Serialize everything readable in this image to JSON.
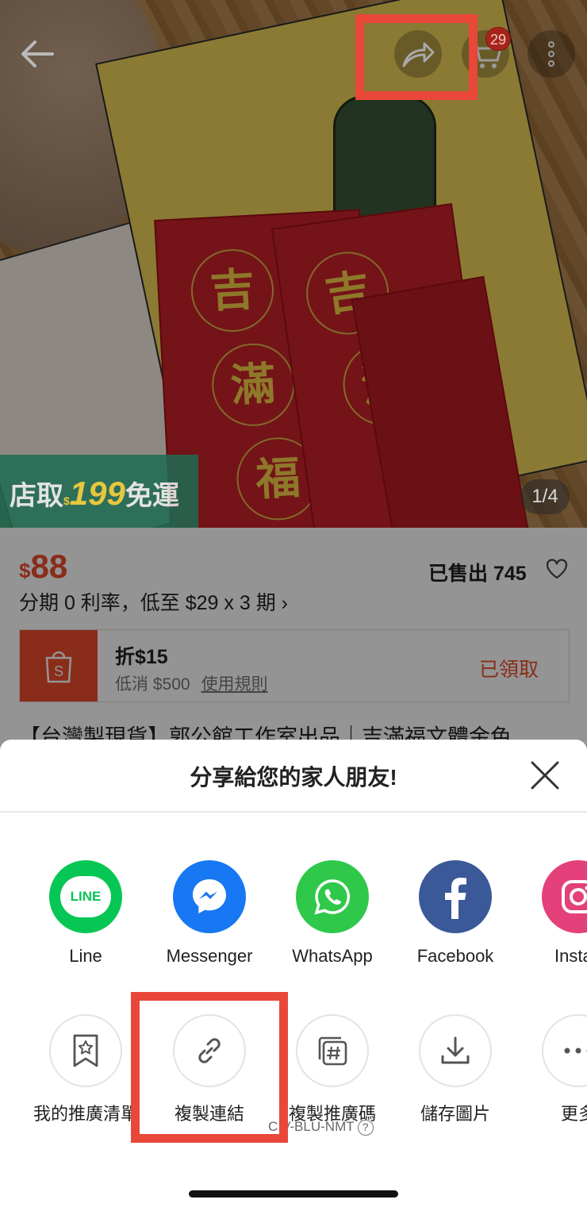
{
  "product": {
    "promo_prefix": "店取",
    "promo_currency": "$",
    "promo_number": "199",
    "promo_suffix": "免運",
    "page_indicator": "1/4",
    "price_symbol": "$",
    "price_value": "88",
    "sold_label": "已售出 745",
    "installment": "分期 0 利率，低至 $29 x 3 期 ›",
    "voucher": {
      "title": "折$15",
      "min_spend": "低消 $500",
      "rules": "使用規則",
      "status": "已領取"
    },
    "title": "【台灣製現貨】郭公館工作室出品｜吉滿福文體金色"
  },
  "envelope_chars": [
    "吉",
    "滿",
    "福"
  ],
  "nav": {
    "cart_badge": "29",
    "icons": [
      "back-arrow-icon",
      "share-icon",
      "cart-icon",
      "more-vertical-icon"
    ]
  },
  "share_sheet": {
    "title": "分享給您的家人朋友!",
    "apps": [
      {
        "label": "Line",
        "icon": "line-icon",
        "color": "#06c755"
      },
      {
        "label": "Messenger",
        "icon": "messenger-icon",
        "color": "#1877f2"
      },
      {
        "label": "WhatsApp",
        "icon": "whatsapp-icon",
        "color": "#2fc84a"
      },
      {
        "label": "Facebook",
        "icon": "facebook-icon",
        "color": "#3b5998"
      },
      {
        "label": "Instag",
        "icon": "instagram-icon",
        "color": "#e4407a"
      }
    ],
    "tools": [
      {
        "label": "我的推廣清單",
        "icon": "bookmark-star-icon"
      },
      {
        "label": "複製連結",
        "icon": "link-icon"
      },
      {
        "label": "複製推廣碼",
        "icon": "hashtag-copy-icon"
      },
      {
        "label": "儲存圖片",
        "icon": "download-icon"
      },
      {
        "label": "更多",
        "icon": "more-horizontal-icon"
      }
    ],
    "referral_code": "C V-BLU-NMT",
    "line_logo_text": "LINE",
    "help_glyph": "?"
  },
  "colors": {
    "accent": "#ee4d2d",
    "highlight": "#e8473a"
  }
}
